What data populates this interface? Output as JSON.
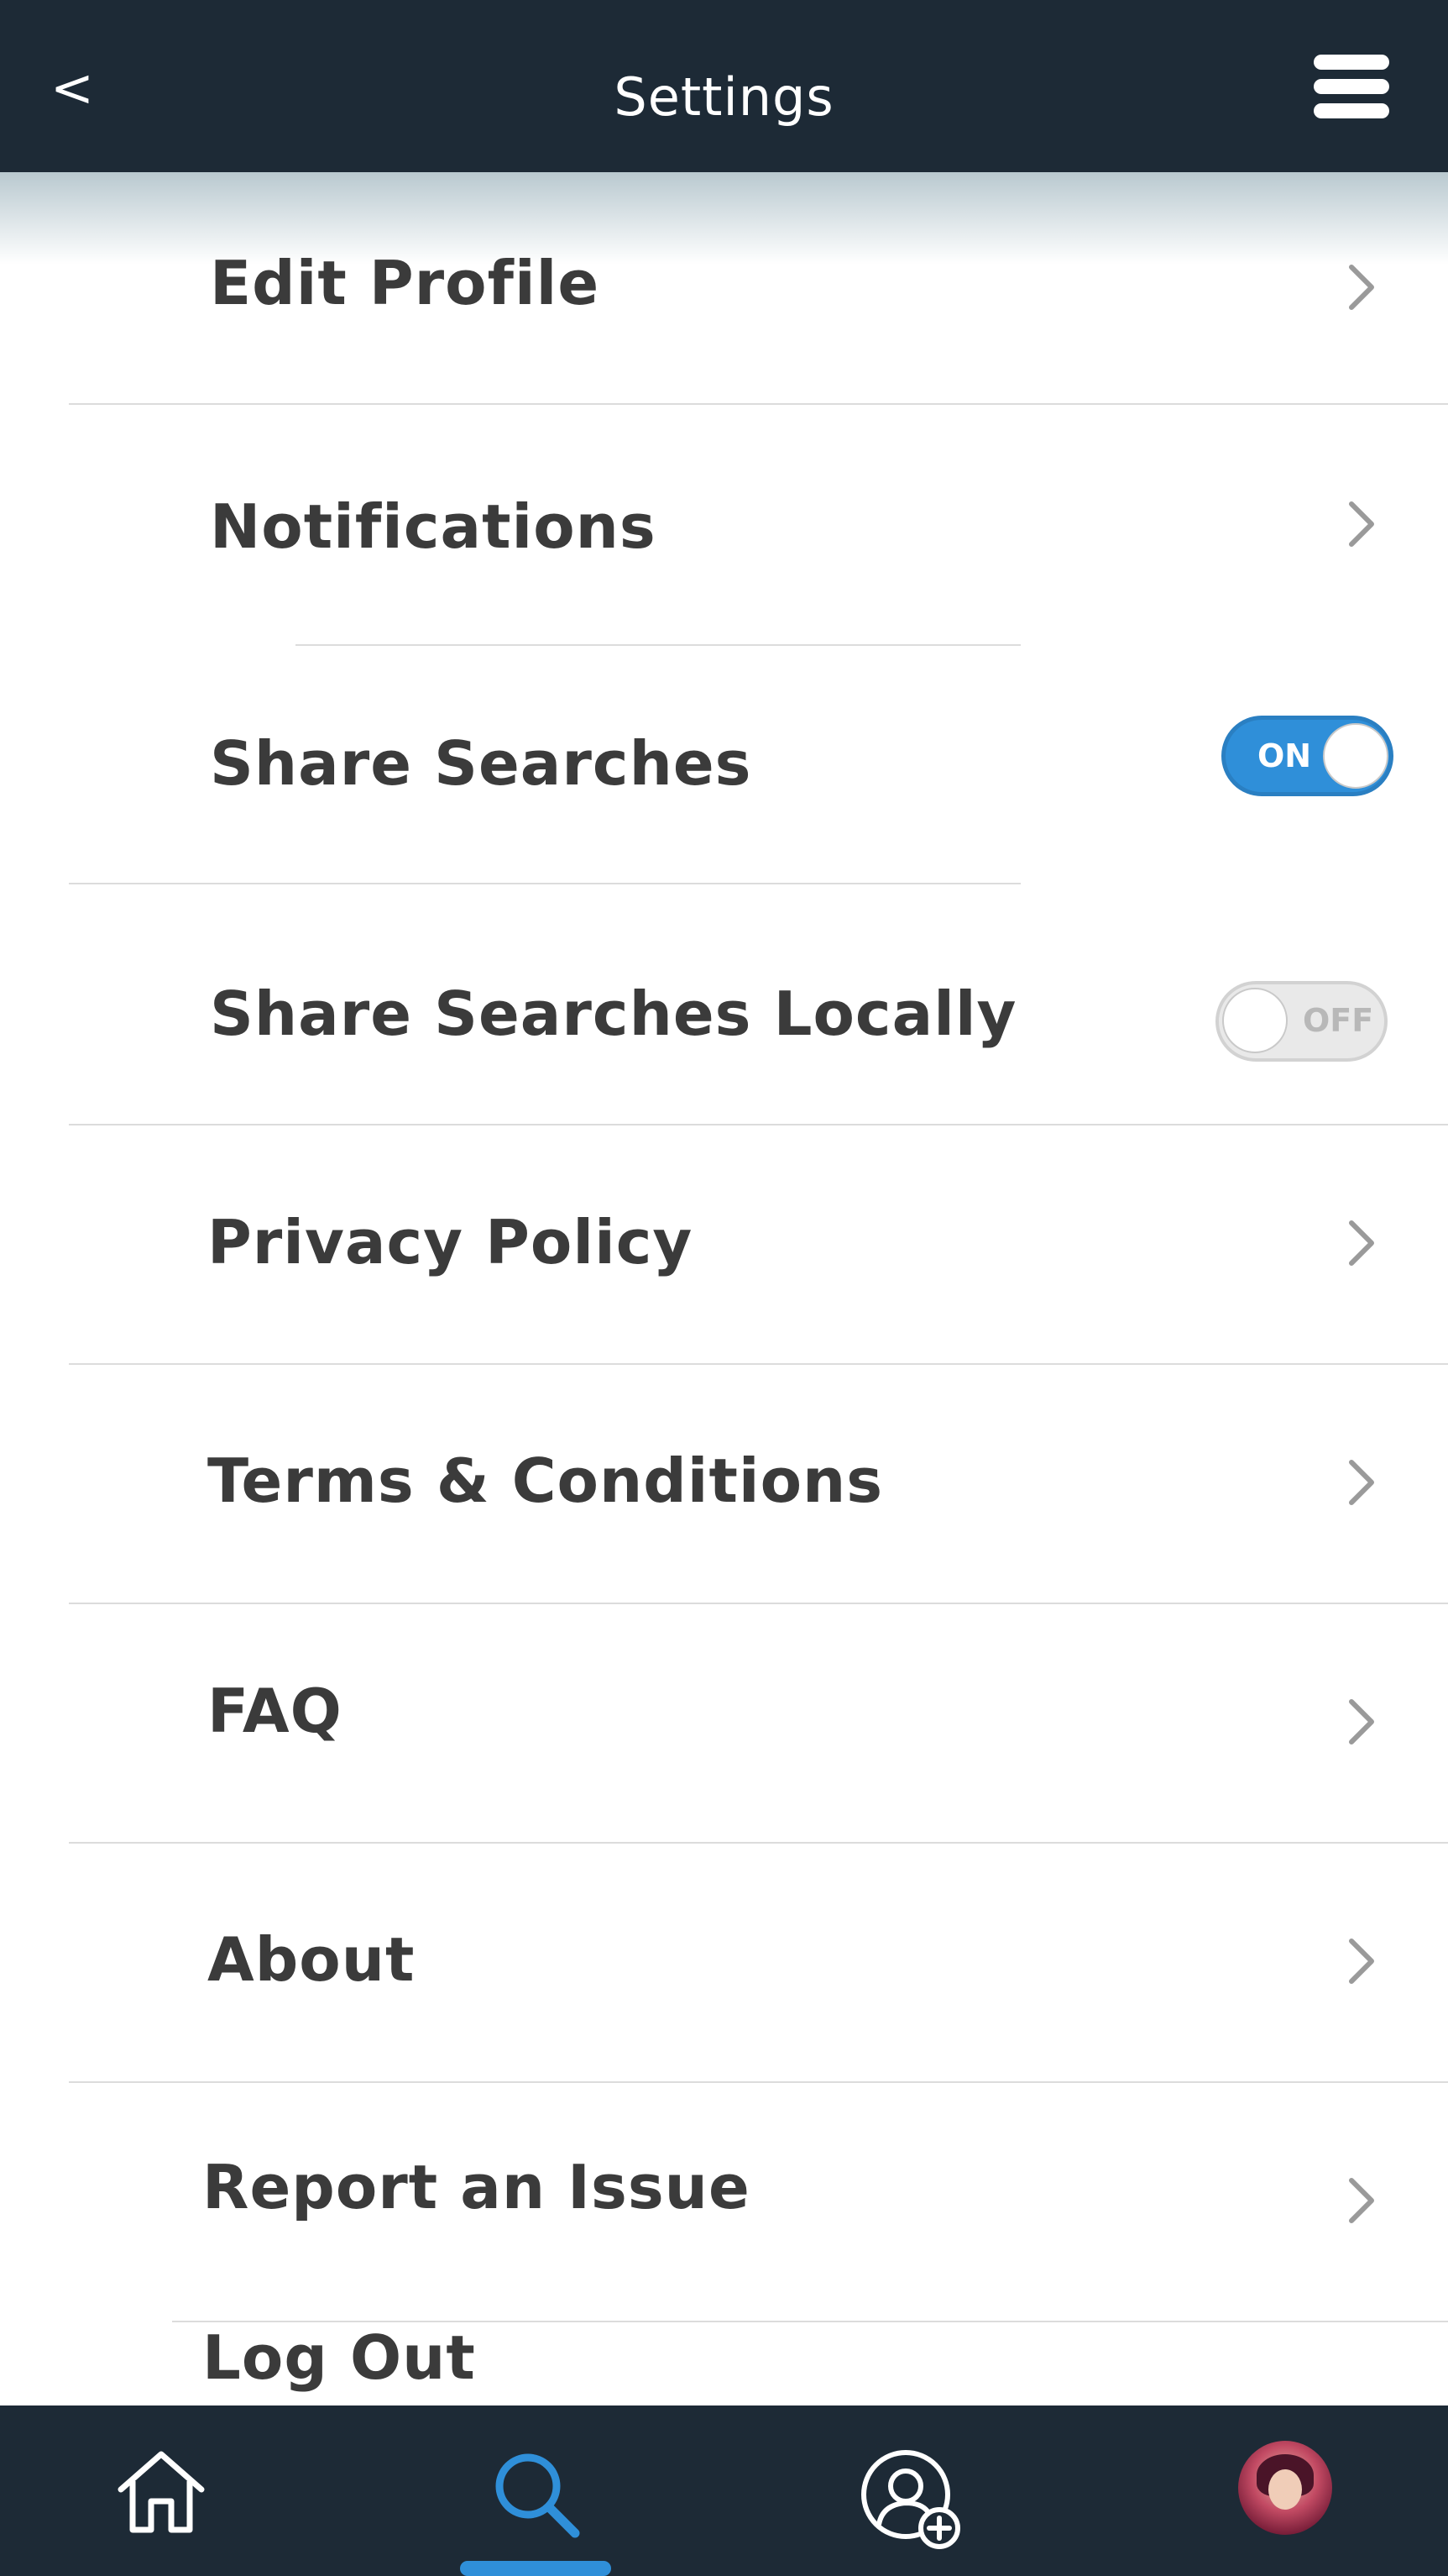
{
  "header": {
    "back_label": "<",
    "title": "Settings",
    "menu_icon": "hamburger-menu-icon"
  },
  "settings": {
    "edit_profile": "Edit Profile",
    "notifications": "Notifications",
    "share_searches": {
      "label": "Share Searches",
      "toggle_text": "ON",
      "state": true
    },
    "share_searches_locally": {
      "label": "Share Searches Locally",
      "toggle_text": "OFF",
      "state": false
    },
    "privacy_policy": "Privacy Policy",
    "terms": "Terms & Conditions",
    "faq": "FAQ",
    "about": "About",
    "report_issue": "Report an Issue",
    "log_out": "Log Out"
  },
  "tabbar": {
    "items": [
      {
        "icon": "home-icon",
        "active": false
      },
      {
        "icon": "search-icon",
        "active": true
      },
      {
        "icon": "add-user-icon",
        "active": false
      },
      {
        "icon": "profile-avatar",
        "active": false
      }
    ]
  },
  "colors": {
    "header_bg": "#1d2a36",
    "accent": "#2f8fd9",
    "text": "#3b3b3b",
    "divider": "#dcdcdc"
  }
}
